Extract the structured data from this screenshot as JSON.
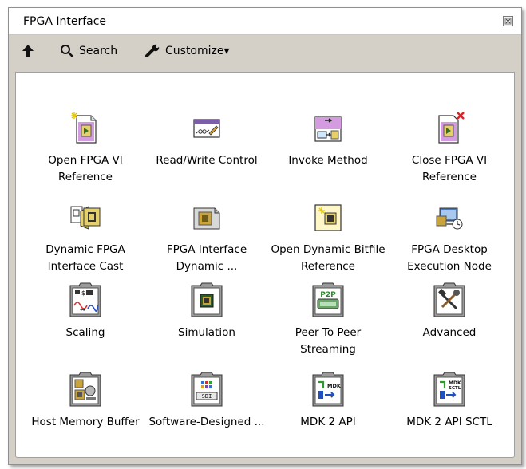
{
  "window": {
    "title": "FPGA Interface"
  },
  "toolbar": {
    "up_icon": "up-arrow-icon",
    "search_label": "Search",
    "customize_label": "Customize▾"
  },
  "palette_items": [
    {
      "label": "Open FPGA VI Reference",
      "icon": "open-fpga-vi-reference-icon"
    },
    {
      "label": "Read/Write Control",
      "icon": "read-write-control-icon"
    },
    {
      "label": "Invoke Method",
      "icon": "invoke-method-icon"
    },
    {
      "label": "Close FPGA VI Reference",
      "icon": "close-fpga-vi-reference-icon"
    },
    {
      "label": "Dynamic FPGA Interface Cast",
      "icon": "dynamic-fpga-interface-cast-icon"
    },
    {
      "label": "FPGA Interface Dynamic ...",
      "icon": "fpga-interface-dynamic-icon"
    },
    {
      "label": "Open Dynamic Bitfile Reference",
      "icon": "open-dynamic-bitfile-reference-icon"
    },
    {
      "label": "FPGA Desktop Execution Node",
      "icon": "fpga-desktop-execution-node-icon"
    },
    {
      "label": "Scaling",
      "icon": "scaling-folder-icon"
    },
    {
      "label": "Simulation",
      "icon": "simulation-folder-icon"
    },
    {
      "label": "Peer To Peer Streaming",
      "icon": "peer-to-peer-folder-icon",
      "icon_text": "P2P"
    },
    {
      "label": "Advanced",
      "icon": "advanced-folder-icon"
    },
    {
      "label": "Host Memory Buffer",
      "icon": "host-memory-buffer-folder-icon"
    },
    {
      "label": "Software-Designed ...",
      "icon": "software-designed-folder-icon",
      "icon_text": "SDI"
    },
    {
      "label": "MDK 2 API",
      "icon": "mdk-2-api-folder-icon",
      "icon_text": "MDK"
    },
    {
      "label": "MDK 2 API SCTL",
      "icon": "mdk-2-api-sctl-folder-icon",
      "icon_text": "MDK SCTL"
    }
  ]
}
